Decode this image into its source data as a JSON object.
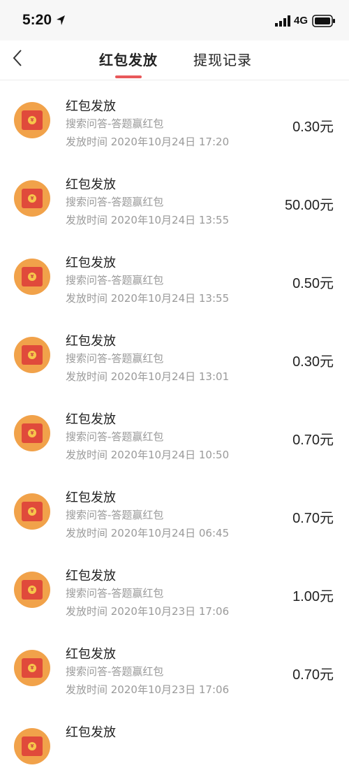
{
  "status": {
    "time": "5:20",
    "network": "4G"
  },
  "nav": {
    "tabs": [
      {
        "label": "红包发放",
        "active": true
      },
      {
        "label": "提现记录",
        "active": false
      }
    ],
    "accent": "#e8585a"
  },
  "records": [
    {
      "title": "红包发放",
      "source": "搜索问答-答题赢红包",
      "time": "发放时间 2020年10月24日 17:20",
      "amount": "0.30元"
    },
    {
      "title": "红包发放",
      "source": "搜索问答-答题赢红包",
      "time": "发放时间 2020年10月24日 13:55",
      "amount": "50.00元"
    },
    {
      "title": "红包发放",
      "source": "搜索问答-答题赢红包",
      "time": "发放时间 2020年10月24日 13:55",
      "amount": "0.50元"
    },
    {
      "title": "红包发放",
      "source": "搜索问答-答题赢红包",
      "time": "发放时间 2020年10月24日 13:01",
      "amount": "0.30元"
    },
    {
      "title": "红包发放",
      "source": "搜索问答-答题赢红包",
      "time": "发放时间 2020年10月24日 10:50",
      "amount": "0.70元"
    },
    {
      "title": "红包发放",
      "source": "搜索问答-答题赢红包",
      "time": "发放时间 2020年10月24日 06:45",
      "amount": "0.70元"
    },
    {
      "title": "红包发放",
      "source": "搜索问答-答题赢红包",
      "time": "发放时间 2020年10月23日 17:06",
      "amount": "1.00元"
    },
    {
      "title": "红包发放",
      "source": "搜索问答-答题赢红包",
      "time": "发放时间 2020年10月23日 17:06",
      "amount": "0.70元"
    },
    {
      "title": "红包发放",
      "source": "",
      "time": "",
      "amount": ""
    }
  ]
}
